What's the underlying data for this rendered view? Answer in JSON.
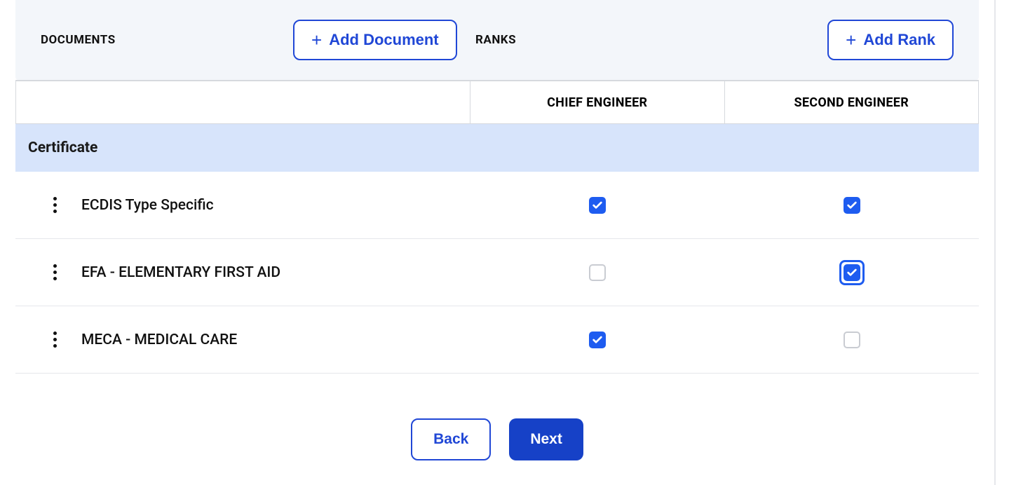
{
  "header": {
    "documents_label": "DOCUMENTS",
    "add_document_label": "Add Document",
    "ranks_label": "RANKS",
    "add_rank_label": "Add Rank"
  },
  "ranks": [
    {
      "label": "CHIEF ENGINEER"
    },
    {
      "label": "SECOND ENGINEER"
    }
  ],
  "group": {
    "label": "Certificate"
  },
  "documents": [
    {
      "name": "ECDIS Type Specific",
      "checks": [
        true,
        true
      ],
      "focused": [
        false,
        false
      ]
    },
    {
      "name": "EFA - ELEMENTARY FIRST AID",
      "checks": [
        false,
        true
      ],
      "focused": [
        false,
        true
      ]
    },
    {
      "name": "MECA - MEDICAL CARE",
      "checks": [
        true,
        false
      ],
      "focused": [
        false,
        false
      ]
    }
  ],
  "footer": {
    "back_label": "Back",
    "next_label": "Next"
  },
  "icons": {
    "plus": "plus-icon",
    "kebab": "kebab-icon",
    "check": "check-icon"
  },
  "colors": {
    "primary": "#1e5cf0",
    "primary_dark": "#1641c7",
    "group_bg": "#d7e4fb",
    "header_bg": "#f3f6fa",
    "border": "#d6d9de"
  }
}
